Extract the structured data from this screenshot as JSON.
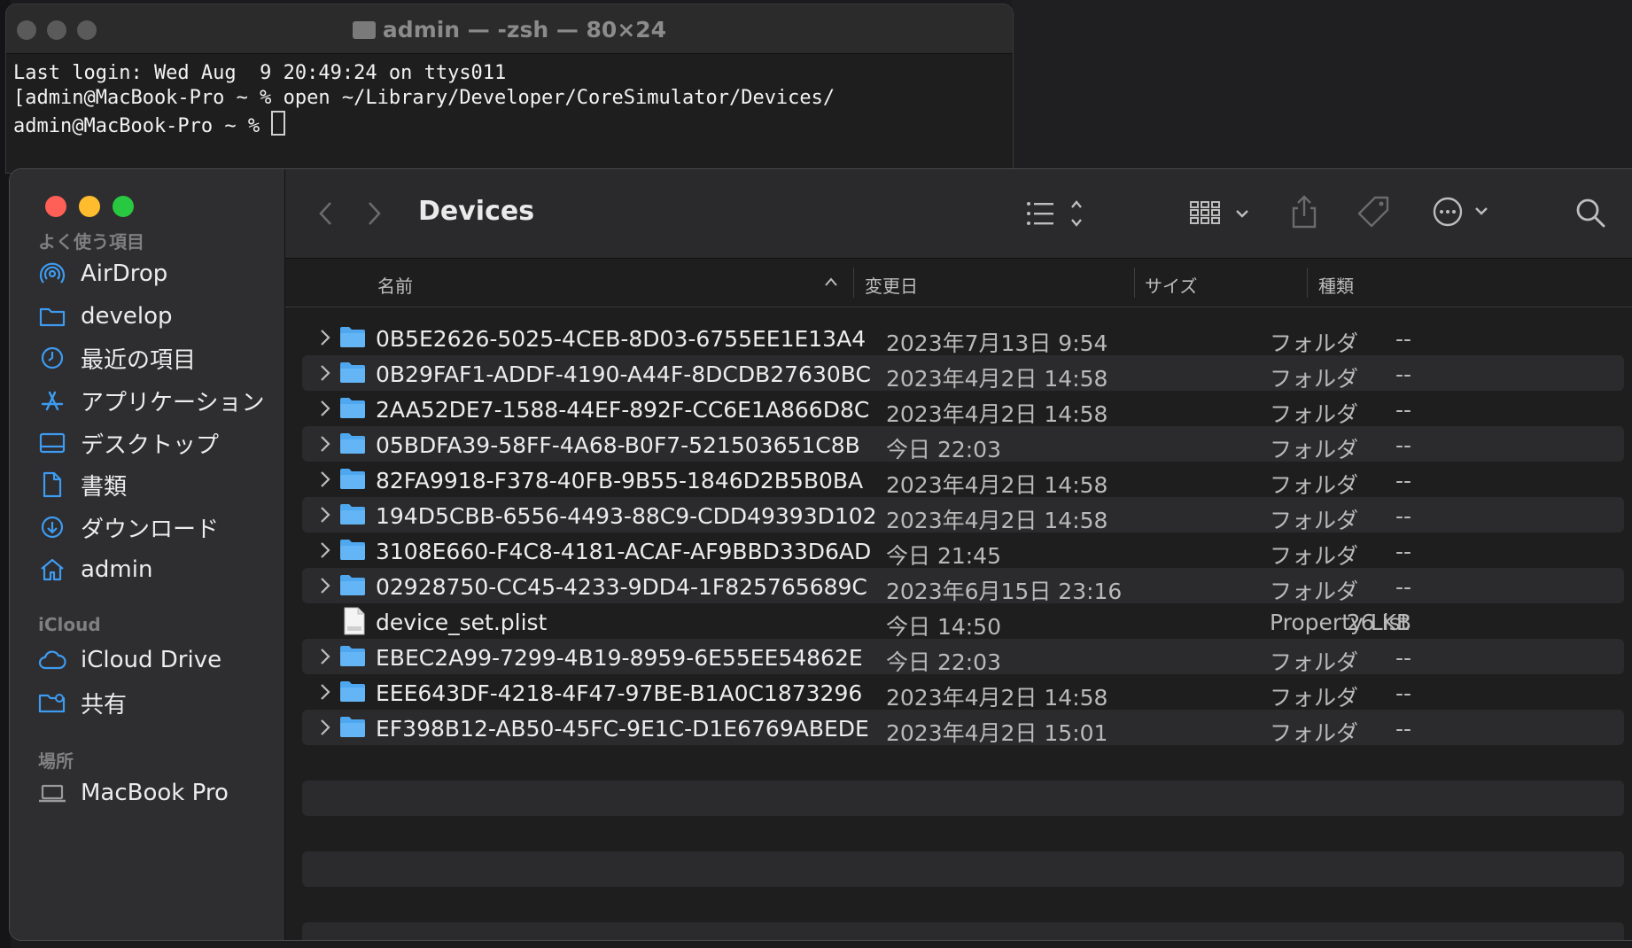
{
  "terminal": {
    "title": "admin — -zsh — 80×24",
    "lines": [
      "Last login: Wed Aug  9 20:49:24 on ttys011",
      "[admin@MacBook-Pro ~ % open ~/Library/Developer/CoreSimulator/Devices/",
      "admin@MacBook-Pro ~ % "
    ]
  },
  "finder": {
    "title": "Devices",
    "sidebar": {
      "favorites_heading": "よく使う項目",
      "favorites": [
        {
          "label": "AirDrop",
          "icon": "airdrop-icon"
        },
        {
          "label": "develop",
          "icon": "folder-icon"
        },
        {
          "label": "最近の項目",
          "icon": "clock-icon"
        },
        {
          "label": "アプリケーション",
          "icon": "applications-icon"
        },
        {
          "label": "デスクトップ",
          "icon": "desktop-icon"
        },
        {
          "label": "書類",
          "icon": "document-icon"
        },
        {
          "label": "ダウンロード",
          "icon": "download-icon"
        },
        {
          "label": "admin",
          "icon": "home-icon"
        }
      ],
      "icloud_heading": "iCloud",
      "icloud": [
        {
          "label": "iCloud Drive",
          "icon": "cloud-icon"
        },
        {
          "label": "共有",
          "icon": "shared-folder-icon"
        }
      ],
      "locations_heading": "場所",
      "locations": [
        {
          "label": "MacBook Pro",
          "icon": "laptop-icon"
        }
      ]
    },
    "columns": {
      "name": "名前",
      "date": "変更日",
      "size": "サイズ",
      "kind": "種類"
    },
    "rows": [
      {
        "name": "0B5E2626-5025-4CEB-8D03-6755EE1E13A4",
        "date": "2023年7月13日 9:54",
        "size": "--",
        "kind": "フォルダ",
        "type": "folder"
      },
      {
        "name": "0B29FAF1-ADDF-4190-A44F-8DCDB27630BC",
        "date": "2023年4月2日 14:58",
        "size": "--",
        "kind": "フォルダ",
        "type": "folder"
      },
      {
        "name": "2AA52DE7-1588-44EF-892F-CC6E1A866D8C",
        "date": "2023年4月2日 14:58",
        "size": "--",
        "kind": "フォルダ",
        "type": "folder"
      },
      {
        "name": "05BDFA39-58FF-4A68-B0F7-521503651C8B",
        "date": "今日 22:03",
        "size": "--",
        "kind": "フォルダ",
        "type": "folder"
      },
      {
        "name": "82FA9918-F378-40FB-9B55-1846D2B5B0BA",
        "date": "2023年4月2日 14:58",
        "size": "--",
        "kind": "フォルダ",
        "type": "folder"
      },
      {
        "name": "194D5CBB-6556-4493-88C9-CDD49393D102",
        "date": "2023年4月2日 14:58",
        "size": "--",
        "kind": "フォルダ",
        "type": "folder"
      },
      {
        "name": "3108E660-F4C8-4181-ACAF-AF9BBD33D6AD",
        "date": "今日 21:45",
        "size": "--",
        "kind": "フォルダ",
        "type": "folder"
      },
      {
        "name": "02928750-CC45-4233-9DD4-1F825765689C",
        "date": "2023年6月15日 23:16",
        "size": "--",
        "kind": "フォルダ",
        "type": "folder"
      },
      {
        "name": "device_set.plist",
        "date": "今日 14:50",
        "size": "26 KB",
        "kind": "Property List",
        "type": "file"
      },
      {
        "name": "EBEC2A99-7299-4B19-8959-6E55EE54862E",
        "date": "今日 22:03",
        "size": "--",
        "kind": "フォルダ",
        "type": "folder"
      },
      {
        "name": "EEE643DF-4218-4F47-97BE-B1A0C1873296",
        "date": "2023年4月2日 14:58",
        "size": "--",
        "kind": "フォルダ",
        "type": "folder"
      },
      {
        "name": "EF398B12-AB50-45FC-9E1C-D1E6769ABEDE",
        "date": "2023年4月2日 15:01",
        "size": "--",
        "kind": "フォルダ",
        "type": "folder"
      }
    ]
  },
  "colors": {
    "accent": "#3d9cf2",
    "folder": "#52a9ee",
    "close": "#fe5f57",
    "minimize": "#febc2e",
    "zoom": "#28c840"
  }
}
